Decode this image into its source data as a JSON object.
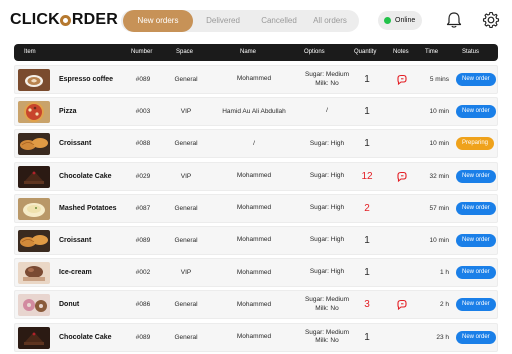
{
  "app": {
    "logo_left": "CLICK",
    "logo_right": "RDER"
  },
  "tabs": [
    "New orders",
    "Delivered",
    "Cancelled",
    "All orders"
  ],
  "online_label": "Online",
  "columns": [
    "Item",
    "Number",
    "Space",
    "Name",
    "Options",
    "Quantity",
    "Notes",
    "Time",
    "Status"
  ],
  "colors": {
    "accent": "#c79257",
    "new_order": "#1a7fe8",
    "preparing": "#efa21b",
    "online": "#22c24a",
    "alert": "#e31e24"
  },
  "orders": [
    {
      "item": "Espresso coffee",
      "number": "#089",
      "space": "General",
      "name": "Mohammed",
      "options": [
        "Sugar: Medium",
        "Milk: No"
      ],
      "quantity": "1",
      "qty_alert": false,
      "note": true,
      "time": "5 mins",
      "status": "New order",
      "thumb": "coffee"
    },
    {
      "item": "Pizza",
      "number": "#003",
      "space": "VIP",
      "name": "Hamid Au Ali Abdullah",
      "options": [
        "/"
      ],
      "quantity": "1",
      "qty_alert": false,
      "note": false,
      "time": "10 min",
      "status": "New order",
      "thumb": "pizza"
    },
    {
      "item": "Croissant",
      "number": "#088",
      "space": "General",
      "name": "/",
      "options": [
        "Sugar: High"
      ],
      "quantity": "1",
      "qty_alert": false,
      "note": false,
      "time": "10 min",
      "status": "Preparing",
      "thumb": "croissant"
    },
    {
      "item": "Chocolate Cake",
      "number": "#029",
      "space": "VIP",
      "name": "Mohammed",
      "options": [
        "Sugar: High"
      ],
      "quantity": "12",
      "qty_alert": true,
      "note": true,
      "time": "32 min",
      "status": "New order",
      "thumb": "cake"
    },
    {
      "item": "Mashed Potatoes",
      "number": "#087",
      "space": "General",
      "name": "Mohammed",
      "options": [
        "Sugar: High"
      ],
      "quantity": "2",
      "qty_alert": true,
      "note": false,
      "time": "57 min",
      "status": "New order",
      "thumb": "potato"
    },
    {
      "item": "Croissant",
      "number": "#089",
      "space": "General",
      "name": "Mohammed",
      "options": [
        "Sugar: High"
      ],
      "quantity": "1",
      "qty_alert": false,
      "note": false,
      "time": "10 min",
      "status": "New order",
      "thumb": "croissant"
    },
    {
      "item": "Ice-cream",
      "number": "#002",
      "space": "VIP",
      "name": "Mohammed",
      "options": [
        "Sugar: High"
      ],
      "quantity": "1",
      "qty_alert": false,
      "note": false,
      "time": "1 h",
      "status": "New order",
      "thumb": "icecream"
    },
    {
      "item": "Donut",
      "number": "#086",
      "space": "General",
      "name": "Mohammed",
      "options": [
        "Sugar: Medium",
        "Milk: No"
      ],
      "quantity": "3",
      "qty_alert": true,
      "note": true,
      "time": "2 h",
      "status": "New order",
      "thumb": "donut"
    },
    {
      "item": "Chocolate Cake",
      "number": "#089",
      "space": "General",
      "name": "Mohammed",
      "options": [
        "Sugar: Medium",
        "Milk: No"
      ],
      "quantity": "1",
      "qty_alert": false,
      "note": false,
      "time": "23 h",
      "status": "New order",
      "thumb": "cake"
    }
  ]
}
